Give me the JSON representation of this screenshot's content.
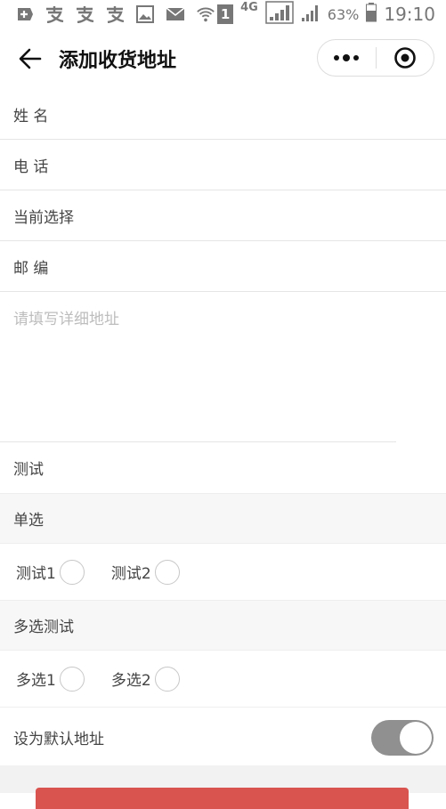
{
  "status_bar": {
    "network": "4G",
    "battery": "63%",
    "time": "19:10",
    "sim_label": "1",
    "left_icons": [
      "add-icon",
      "alipay-icon",
      "alipay-icon",
      "alipay-icon",
      "image-icon",
      "mail-icon",
      "wifi-icon"
    ]
  },
  "nav": {
    "title": "添加收货地址"
  },
  "form": {
    "name_label": "姓 名",
    "phone_label": "电 话",
    "region_label": "当前选择",
    "zip_label": "邮 编",
    "address_placeholder": "请填写详细地址",
    "test_label": "测试"
  },
  "single_choice": {
    "title": "单选",
    "options": [
      "测试1",
      "测试2"
    ]
  },
  "multi_choice": {
    "title": "多选测试",
    "options": [
      "多选1",
      "多选2"
    ]
  },
  "default_address": {
    "label": "设为默认地址",
    "enabled": true
  },
  "colors": {
    "toggle_on": "#909090",
    "submit_button": "#d9534f"
  }
}
